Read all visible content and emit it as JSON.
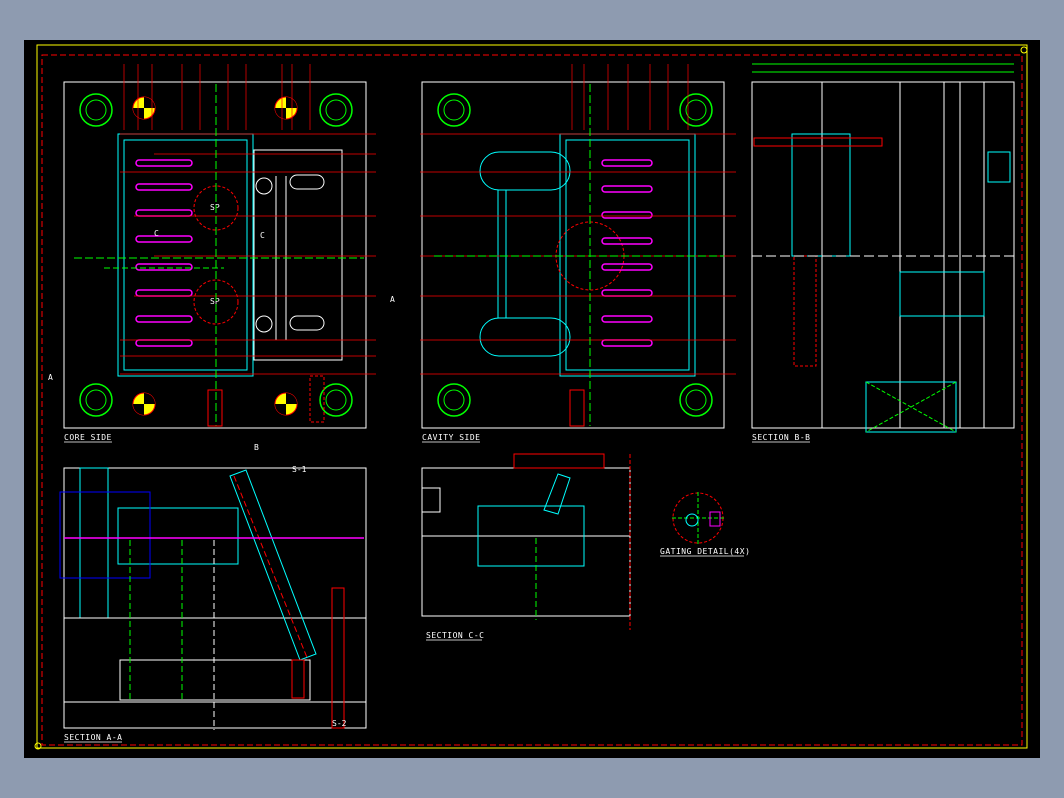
{
  "drawing": {
    "colors": {
      "background": "#000000",
      "frame": "#ffff00",
      "border_dash": "#ff0000",
      "plate": "#ffffff",
      "cavity": "#00ffff",
      "center": "#00ff00",
      "red": "#ff0000",
      "magenta": "#ff00ff",
      "blue": "#0000ff",
      "yellow": "#ffff00"
    },
    "views": {
      "core_side": {
        "label": "CORE SIDE"
      },
      "cavity_side": {
        "label": "CAVITY SIDE"
      },
      "section_bb": {
        "label": "SECTION B-B"
      },
      "section_aa": {
        "label": "SECTION A-A"
      },
      "section_cc": {
        "label": "SECTION C-C"
      },
      "gating_detail": {
        "label": "GATING DETAIL(4X)"
      }
    },
    "section_marks": [
      "A",
      "A",
      "B",
      "B",
      "C",
      "C"
    ],
    "part_tags": {
      "sp_upper": "SP",
      "sp_lower": "SP",
      "s2": "S-2",
      "s1": "S-1"
    }
  }
}
